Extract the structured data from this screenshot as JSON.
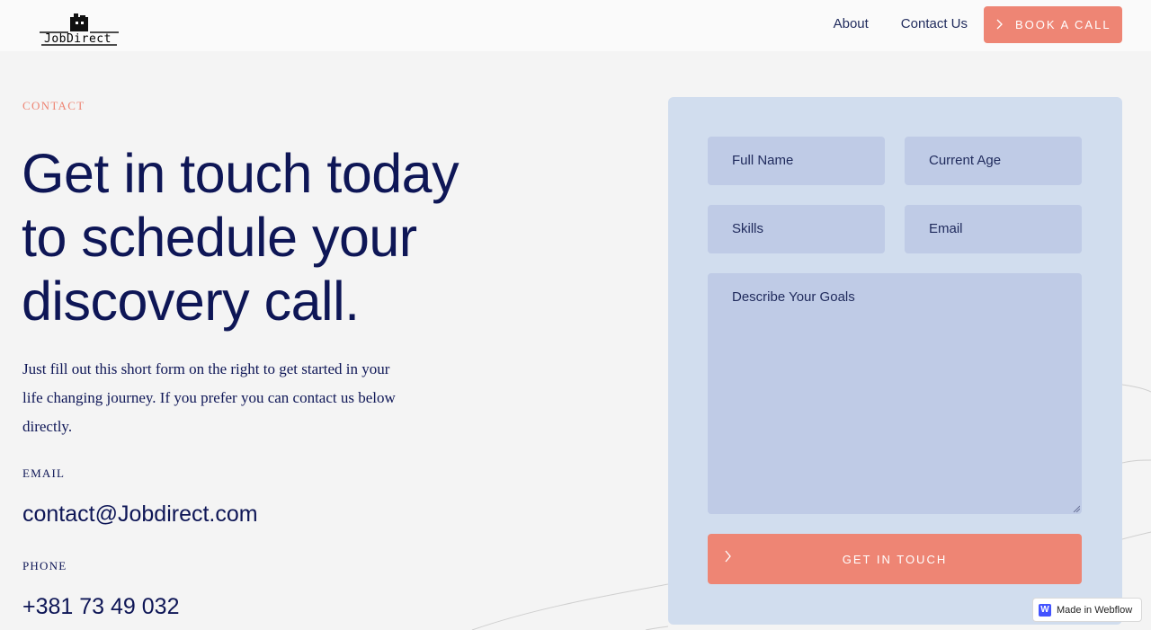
{
  "nav": {
    "logo_text": "JobDirect",
    "links": [
      {
        "label": "About"
      },
      {
        "label": "Contact Us"
      }
    ],
    "cta_label": "BOOK A CALL",
    "cta_icon": "chevron-right-icon"
  },
  "hero": {
    "eyebrow": "CONTACT",
    "headline_lines": [
      "Get in touch today",
      "to schedule your",
      "discovery call."
    ],
    "intro_lines": [
      "Just fill out this short form on the right to get started in your",
      "life changing journey. If you prefer you can contact us below",
      "directly."
    ]
  },
  "contact": {
    "email_label": "EMAIL",
    "email_value": "contact@Jobdirect.com",
    "phone_label": "PHONE",
    "phone_value": "+381 73 49 032"
  },
  "form": {
    "full_name_placeholder": "Full Name",
    "age_placeholder": "Current Age",
    "skills_placeholder": "Skills",
    "email_placeholder": "Email",
    "goals_placeholder": "Describe Your Goals",
    "submit_label": "GET IN TOUCH",
    "submit_icon": "chevron-right-icon"
  },
  "badge": {
    "logo_letter": "W",
    "text": "Made in Webflow"
  },
  "colors": {
    "accent": "#ee8574",
    "navy": "#0e1656",
    "form_bg": "#d1ddee",
    "field_bg": "#bfcbe6"
  }
}
